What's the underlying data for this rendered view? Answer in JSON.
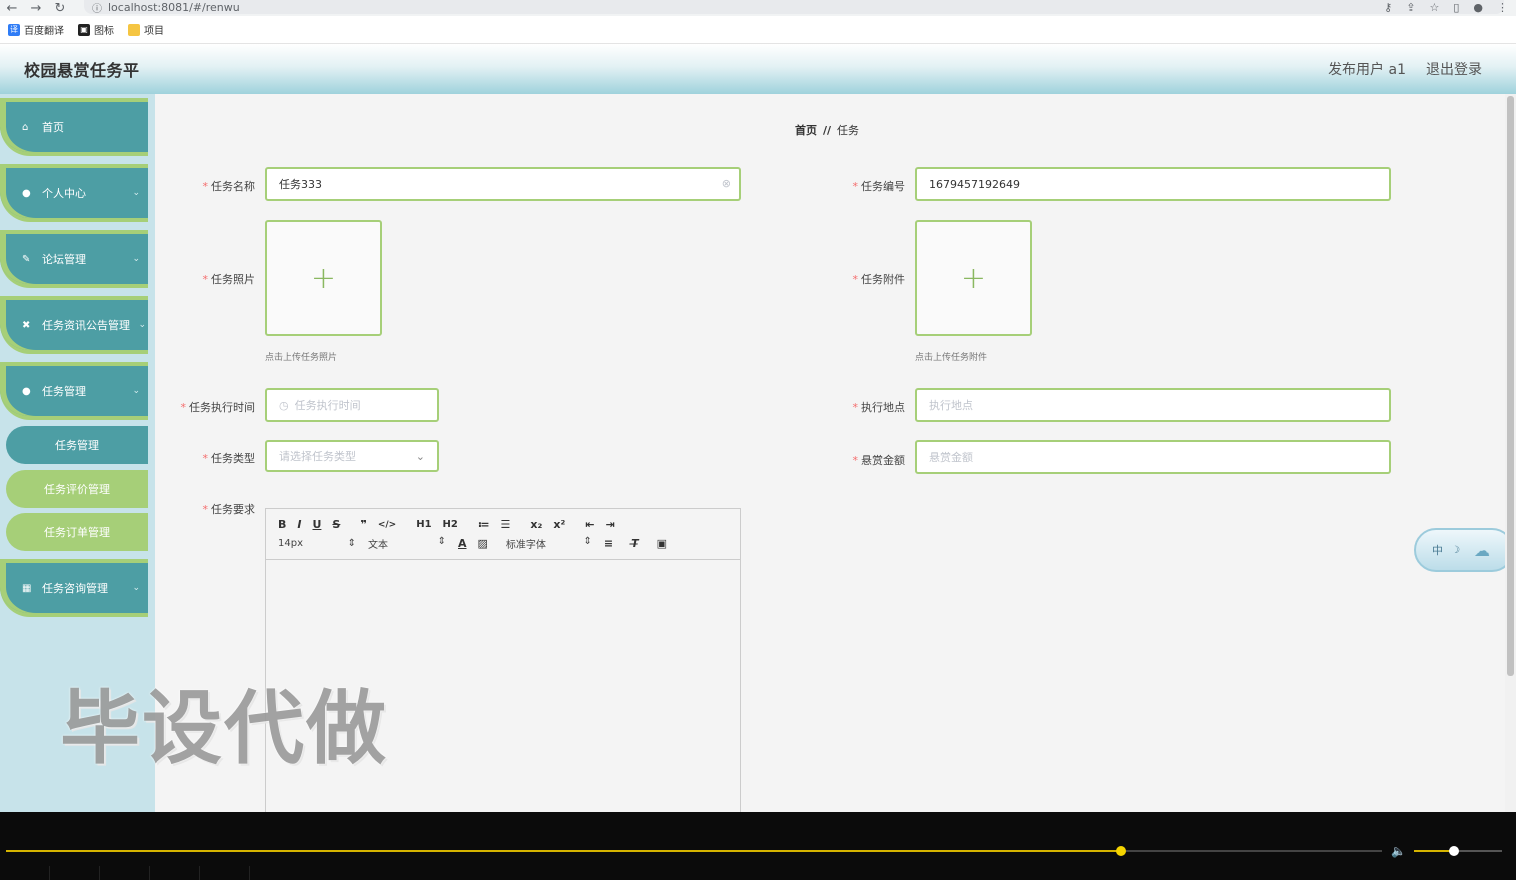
{
  "browser": {
    "url": "localhost:8081/#/renwu",
    "bookmarks": [
      {
        "label": "百度翻译",
        "icon": "translate-icon",
        "color": "#2f7cf6"
      },
      {
        "label": "图标",
        "icon": "image-icon",
        "color": "#222222"
      },
      {
        "label": "项目",
        "icon": "folder-icon",
        "color": "#f5c542"
      }
    ]
  },
  "header": {
    "title": "校园悬赏任务平",
    "user": "发布用户 a1",
    "logout": "退出登录"
  },
  "sidebar": {
    "items": [
      {
        "label": "首页",
        "icon": "home-icon"
      },
      {
        "label": "个人中心",
        "icon": "user-icon"
      },
      {
        "label": "论坛管理",
        "icon": "forum-icon"
      },
      {
        "label": "任务资讯公告管理",
        "icon": "ticket-icon"
      },
      {
        "label": "任务管理",
        "icon": "user-icon"
      },
      {
        "label": "任务咨询管理",
        "icon": "grid-icon"
      }
    ],
    "subitems": [
      {
        "label": "任务管理",
        "active": true
      },
      {
        "label": "任务评价管理",
        "active": false
      },
      {
        "label": "任务订单管理",
        "active": false
      }
    ]
  },
  "breadcrumb": {
    "home": "首页",
    "sep": "//",
    "current": "任务"
  },
  "form": {
    "task_name": {
      "label": "任务名称",
      "value": "任务333"
    },
    "task_no": {
      "label": "任务编号",
      "value": "1679457192649"
    },
    "task_photo": {
      "label": "任务照片",
      "hint": "点击上传任务照片"
    },
    "task_attachment": {
      "label": "任务附件",
      "hint": "点击上传任务附件"
    },
    "exec_time": {
      "label": "任务执行时间",
      "placeholder": "任务执行时间"
    },
    "exec_place": {
      "label": "执行地点",
      "placeholder": "执行地点"
    },
    "task_type": {
      "label": "任务类型",
      "placeholder": "请选择任务类型"
    },
    "reward": {
      "label": "悬赏金额",
      "placeholder": "悬赏金额"
    },
    "requirement": {
      "label": "任务要求"
    }
  },
  "editor": {
    "toolbar_row1": [
      "B",
      "I",
      "U",
      "S",
      "❞",
      "</>",
      "H1",
      "H2",
      "≔",
      "☰",
      "x₂",
      "x²",
      "⇤",
      "⇥"
    ],
    "font_size": "14px",
    "block": "文本",
    "font_family": "标准字体"
  },
  "ime": {
    "label": "中"
  },
  "watermark": "毕设代做",
  "player": {
    "progress": 0.81,
    "volume": 0.45
  }
}
